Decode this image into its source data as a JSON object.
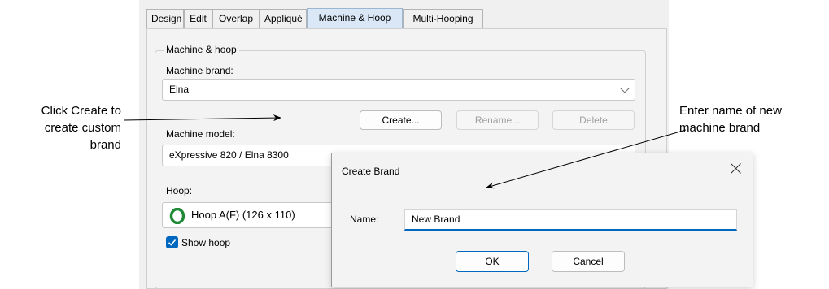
{
  "tabs": [
    "Design",
    "Edit",
    "Overlap",
    "Appliqué",
    "Machine & Hoop",
    "Multi-Hooping"
  ],
  "active_tab": "Machine & Hoop",
  "group": {
    "title": "Machine & hoop",
    "brand_label": "Machine brand:",
    "brand_value": "Elna",
    "buttons": {
      "create": "Create...",
      "rename": "Rename...",
      "delete": "Delete"
    },
    "model_label": "Machine model:",
    "model_value": "eXpressive 820 / Elna 8300",
    "hoop_label": "Hoop:",
    "hoop_value": "Hoop A(F) (126 x 110)",
    "show_hoop_label": "Show hoop",
    "show_hoop_checked": true
  },
  "dialog": {
    "title": "Create Brand",
    "name_label": "Name:",
    "name_value": "New Brand",
    "ok": "OK",
    "cancel": "Cancel"
  },
  "annotations": {
    "left": [
      "Click Create to",
      "create custom",
      "brand"
    ],
    "right": [
      "Enter name of new",
      "machine brand"
    ]
  },
  "colors": {
    "active_tab": "#d9e7f6",
    "focus_underline": "#0067c0",
    "checkbox": "#0067c0",
    "hoop_icon": "#1f8a36"
  }
}
